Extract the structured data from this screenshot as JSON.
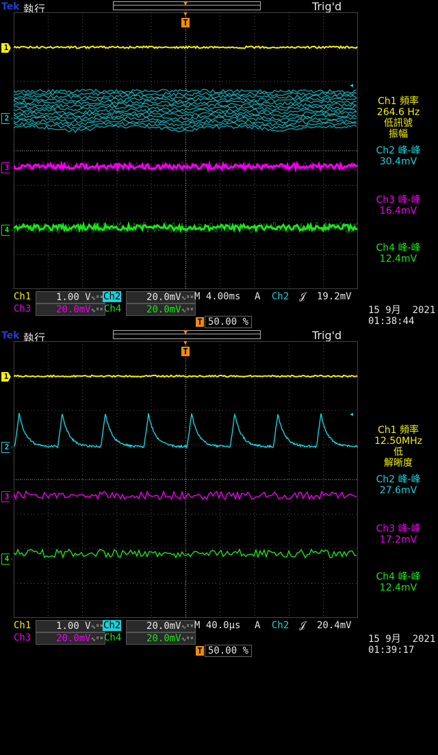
{
  "colors": {
    "ch1": "#f4f000",
    "ch2": "#19d2dc",
    "ch3": "#f000f0",
    "ch4": "#19e619",
    "grid": "#5a5a5a",
    "trigger": "#f08a10",
    "text": "#e6e6e6",
    "brand": "#1f3fd6"
  },
  "icons": {
    "trigger_marker": "T-arrow-down",
    "ch_marker": "channel-tab-arrow",
    "edge_rising": "rising-edge-icon",
    "coupling": "bandwidth-limit-icon"
  },
  "screens": [
    {
      "header": {
        "brand": "Tek",
        "run_state": "執行",
        "trigger_state": "Trig'd"
      },
      "measurements": [
        {
          "lines": [
            "Ch1 頻率",
            "264.6 Hz",
            "低訊號",
            "振幅"
          ],
          "color_key": "ch1"
        },
        {
          "lines": [
            "Ch2 峰-峰",
            "30.4mV"
          ],
          "color_key": "ch2"
        },
        {
          "lines": [
            "Ch3 峰-峰",
            "16.4mV"
          ],
          "color_key": "ch3"
        },
        {
          "lines": [
            "Ch4 峰-峰",
            "12.4mV"
          ],
          "color_key": "ch4"
        }
      ],
      "channels": {
        "ch1": {
          "label": "Ch1",
          "scale": "1.00 V"
        },
        "ch2": {
          "label": "Ch2",
          "scale": "20.0mV"
        },
        "ch3": {
          "label": "Ch3",
          "scale": "20.0mV"
        },
        "ch4": {
          "label": "Ch4",
          "scale": "20.0mV"
        }
      },
      "timebase": "M 4.00ms",
      "trigger": {
        "mode": "A",
        "source": "Ch2",
        "edge": "𝒥",
        "level": "19.2mV",
        "position": "50.00 %"
      },
      "date": "15 9月  2021",
      "time": "01:38:44",
      "markers": [
        "1",
        "2",
        "3",
        "4"
      ],
      "trace_style": "noise-band"
    },
    {
      "header": {
        "brand": "Tek",
        "run_state": "執行",
        "trigger_state": "Trig'd"
      },
      "measurements": [
        {
          "lines": [
            "Ch1 頻率",
            "12.50MHz",
            "低",
            "解晰度"
          ],
          "color_key": "ch1"
        },
        {
          "lines": [
            "Ch2 峰-峰",
            "27.6mV"
          ],
          "color_key": "ch2"
        },
        {
          "lines": [
            "Ch3 峰-峰",
            "17.2mV"
          ],
          "color_key": "ch3"
        },
        {
          "lines": [
            "Ch4 峰-峰",
            "12.4mV"
          ],
          "color_key": "ch4"
        }
      ],
      "channels": {
        "ch1": {
          "label": "Ch1",
          "scale": "1.00 V"
        },
        "ch2": {
          "label": "Ch2",
          "scale": "20.0mV"
        },
        "ch3": {
          "label": "Ch3",
          "scale": "20.0mV"
        },
        "ch4": {
          "label": "Ch4",
          "scale": "20.0mV"
        }
      },
      "timebase": "M 40.0µs",
      "trigger": {
        "mode": "A",
        "source": "Ch2",
        "edge": "𝒥",
        "level": "20.4mV",
        "position": "50.00 %"
      },
      "date": "15 9月  2021",
      "time": "01:39:17",
      "markers": [
        "1",
        "2",
        "3",
        "4"
      ],
      "trace_style": "detailed"
    }
  ]
}
